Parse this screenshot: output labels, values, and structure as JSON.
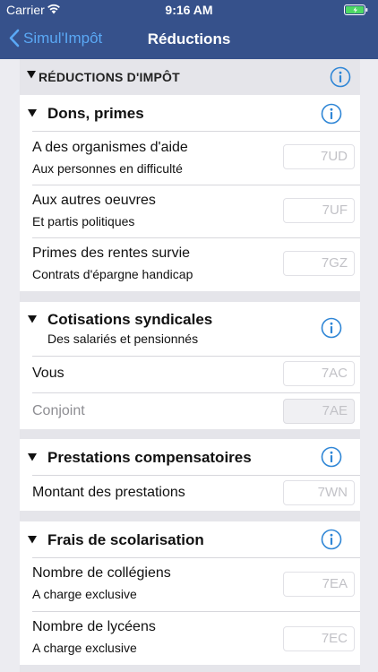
{
  "status_bar": {
    "carrier": "Carrier",
    "time": "9:16 AM"
  },
  "nav": {
    "back_label": "Simul'Impôt",
    "title": "Réductions"
  },
  "section": {
    "title": "RÉDUCTIONS D'IMPÔT"
  },
  "cards": [
    {
      "title": "Dons, primes",
      "rows": [
        {
          "label": "A des organismes d'aide",
          "sub": "Aux personnes en difficulté",
          "code": "7UD"
        },
        {
          "label": "Aux autres oeuvres",
          "sub": "Et partis politiques",
          "code": "7UF"
        },
        {
          "label": "Primes des rentes survie",
          "sub": "Contrats d'épargne handicap",
          "code": "7GZ"
        }
      ]
    },
    {
      "title": "Cotisations syndicales",
      "subtitle": "Des salariés et pensionnés",
      "rows": [
        {
          "label": "Vous",
          "code": "7AC"
        },
        {
          "label": "Conjoint",
          "code": "7AE"
        }
      ]
    },
    {
      "title": "Prestations compensatoires",
      "rows": [
        {
          "label": "Montant des prestations",
          "code": "7WN"
        }
      ]
    },
    {
      "title": "Frais de scolarisation",
      "rows": [
        {
          "label": "Nombre de collégiens",
          "sub": "A charge exclusive",
          "code": "7EA"
        },
        {
          "label": "Nombre de lycéens",
          "sub": "A charge exclusive",
          "code": "7EC"
        }
      ]
    }
  ],
  "colors": {
    "nav_background": "#36518b",
    "accent": "#2f86d6",
    "back_link": "#5aa8f5"
  },
  "icons": [
    "wifi-icon",
    "battery-icon",
    "back-chevron-icon",
    "triangle-down-icon",
    "info-icon"
  ]
}
